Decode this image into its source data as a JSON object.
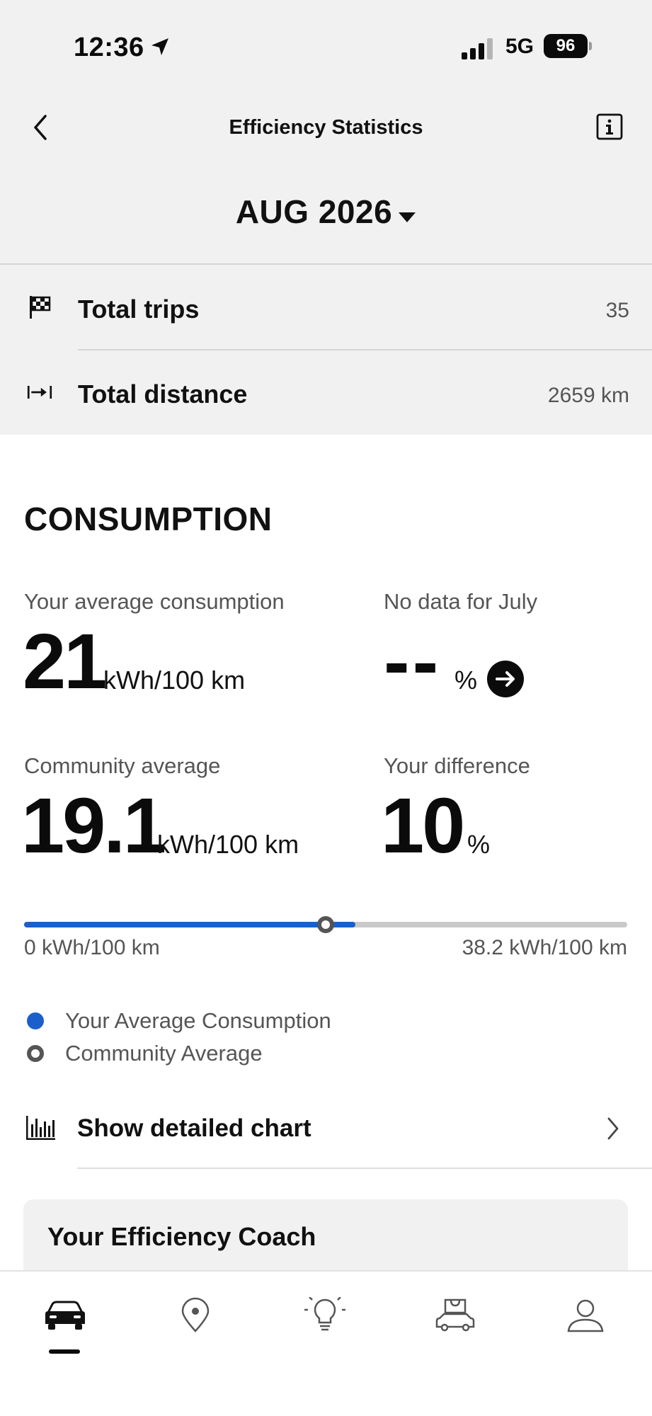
{
  "status_bar": {
    "time": "12:36",
    "network": "5G",
    "battery": "96"
  },
  "header": {
    "title": "Efficiency Statistics",
    "back_icon": "chevron-left-icon",
    "info_icon": "info-icon"
  },
  "period": {
    "label": "AUG 2026"
  },
  "summary": {
    "total_trips_label": "Total trips",
    "total_trips_value": "35",
    "total_distance_label": "Total distance",
    "total_distance_value": "2659 km"
  },
  "consumption": {
    "title": "CONSUMPTION",
    "your_average_label": "Your average consumption",
    "your_average_value": "21",
    "your_average_unit": "kWh/100 km",
    "previous_label": "No data for July",
    "previous_value": "--",
    "previous_unit": "%",
    "community_label": "Community average",
    "community_value": "19.1",
    "community_unit": "kWh/100 km",
    "difference_label": "Your difference",
    "difference_value": "10",
    "difference_unit": "%",
    "range_min_label": "0 kWh/100 km",
    "range_max_label": "38.2 kWh/100 km",
    "range_min": 0,
    "range_max": 38.2,
    "your_value_numeric": 21,
    "community_value_numeric": 19.1,
    "legend_your": "Your Average Consumption",
    "legend_community": "Community Average",
    "show_chart_label": "Show detailed chart"
  },
  "coach": {
    "title": "Your Efficiency Coach"
  },
  "colors": {
    "accent_blue": "#1c5fcc",
    "bar_grey": "#c9c9c9",
    "header_bg": "#f1f1f1"
  },
  "tabbar": {
    "tabs": [
      "car-icon",
      "location-pin-icon",
      "lightbulb-icon",
      "car-shop-icon",
      "profile-icon"
    ],
    "active_index": 0
  }
}
